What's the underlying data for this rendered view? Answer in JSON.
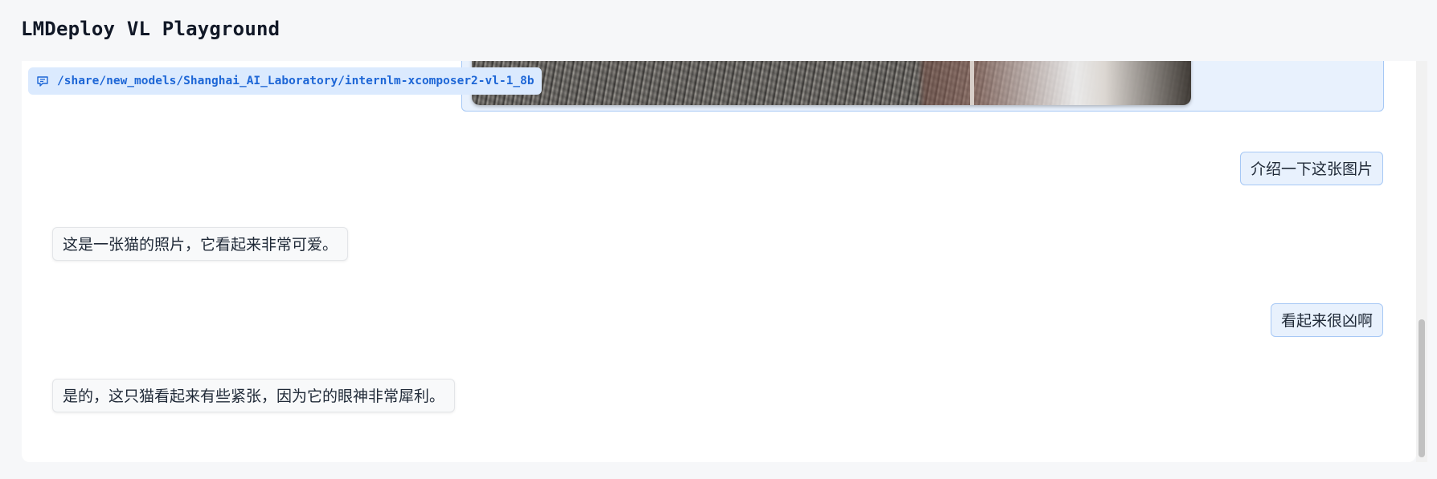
{
  "app": {
    "title": "LMDeploy VL Playground"
  },
  "chatbot": {
    "model_label": "/share/new_models/Shanghai_AI_Laboratory/internlm-xcomposer2-vl-1_8b",
    "messages": [
      {
        "role": "user",
        "type": "image",
        "alt": "cat photo"
      },
      {
        "role": "user",
        "type": "text",
        "text": "介绍一下这张图片"
      },
      {
        "role": "bot",
        "type": "text",
        "text": "这是一张猫的照片，它看起来非常可爱。"
      },
      {
        "role": "user",
        "type": "text",
        "text": "看起来很凶啊"
      },
      {
        "role": "bot",
        "type": "text",
        "text": "是的，这只猫看起来有些紧张，因为它的眼神非常犀利。"
      }
    ]
  },
  "icons": {
    "model_badge_icon": "chat-bubble-icon"
  },
  "colors": {
    "accent": "#1d66d6",
    "user_bubble_bg": "#e8f1fd",
    "user_bubble_border": "#a6c8f5",
    "bot_bubble_bg": "#f8f9fa",
    "badge_bg": "#dbeafe"
  }
}
